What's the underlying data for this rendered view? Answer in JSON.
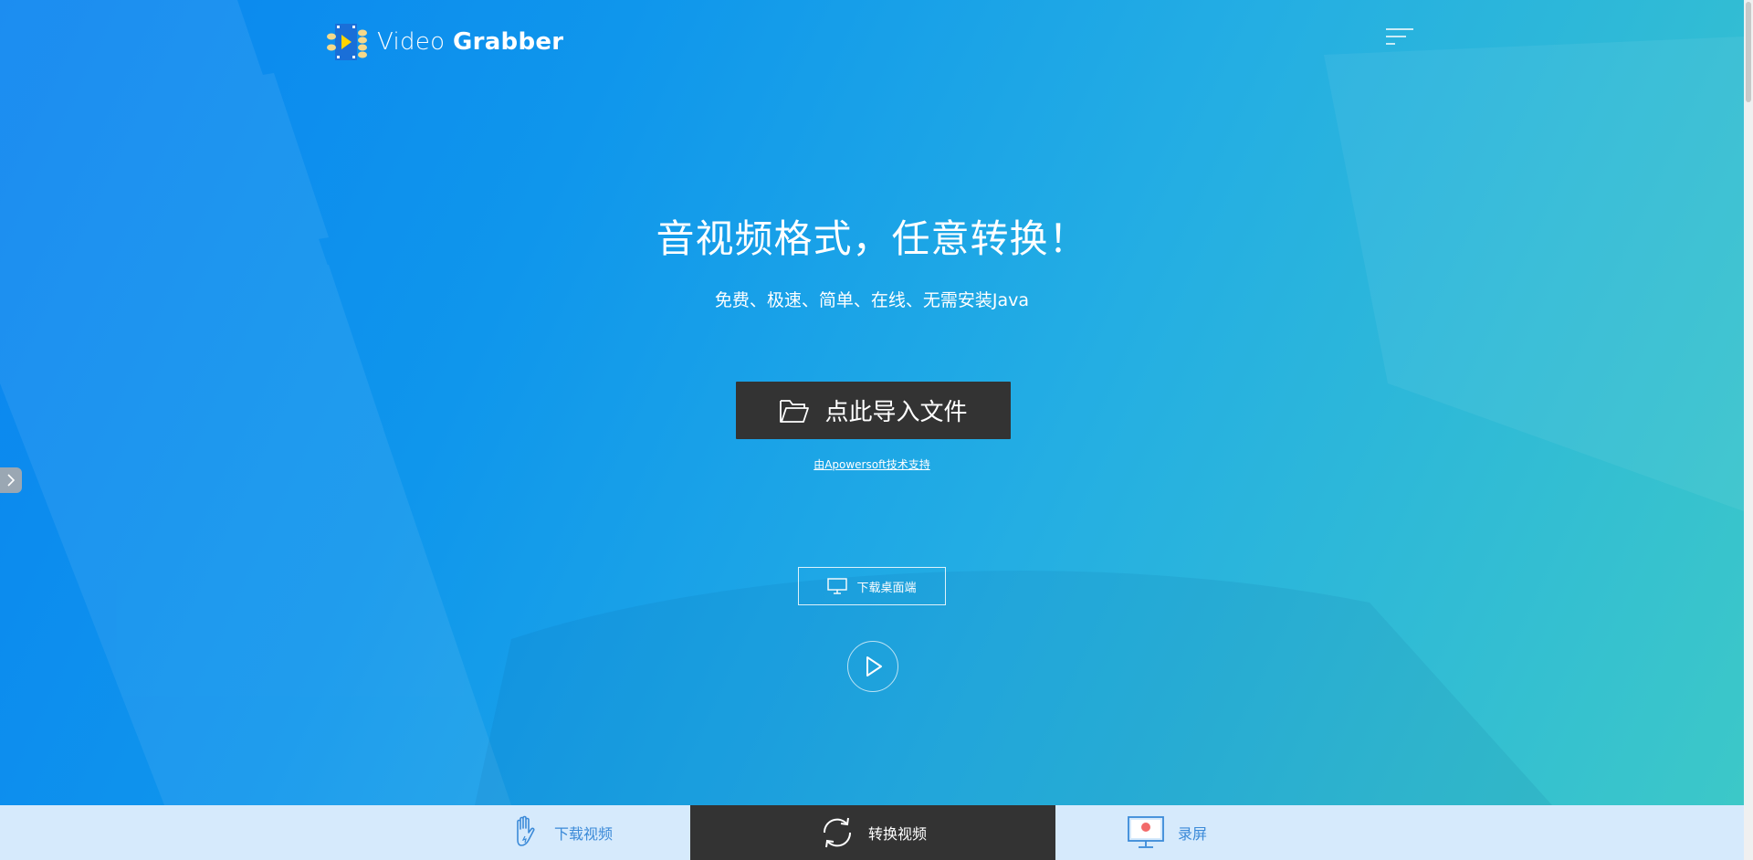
{
  "brand": {
    "name_light": "Video",
    "name_bold": "Grabber"
  },
  "hero": {
    "headline": "音视频格式，任意转换！",
    "subheadline": "免费、极速、简单、在线、无需安装Java",
    "import_button_label": "点此导入文件",
    "powered_by": "由Apowersoft技术支持",
    "desktop_button_label": "下载桌面端"
  },
  "bottom_nav": {
    "items": [
      {
        "label": "下载视频",
        "icon": "hand-icon",
        "active": false
      },
      {
        "label": "转换视频",
        "icon": "convert-arrows-icon",
        "active": true
      },
      {
        "label": "录屏",
        "icon": "monitor-record-icon",
        "active": false
      }
    ]
  },
  "colors": {
    "hero_start": "#0a84f0",
    "hero_end": "#3cc8c8",
    "button_dark": "#333333",
    "nav_bg": "#d6eafc",
    "nav_text": "#3b8ad8"
  }
}
